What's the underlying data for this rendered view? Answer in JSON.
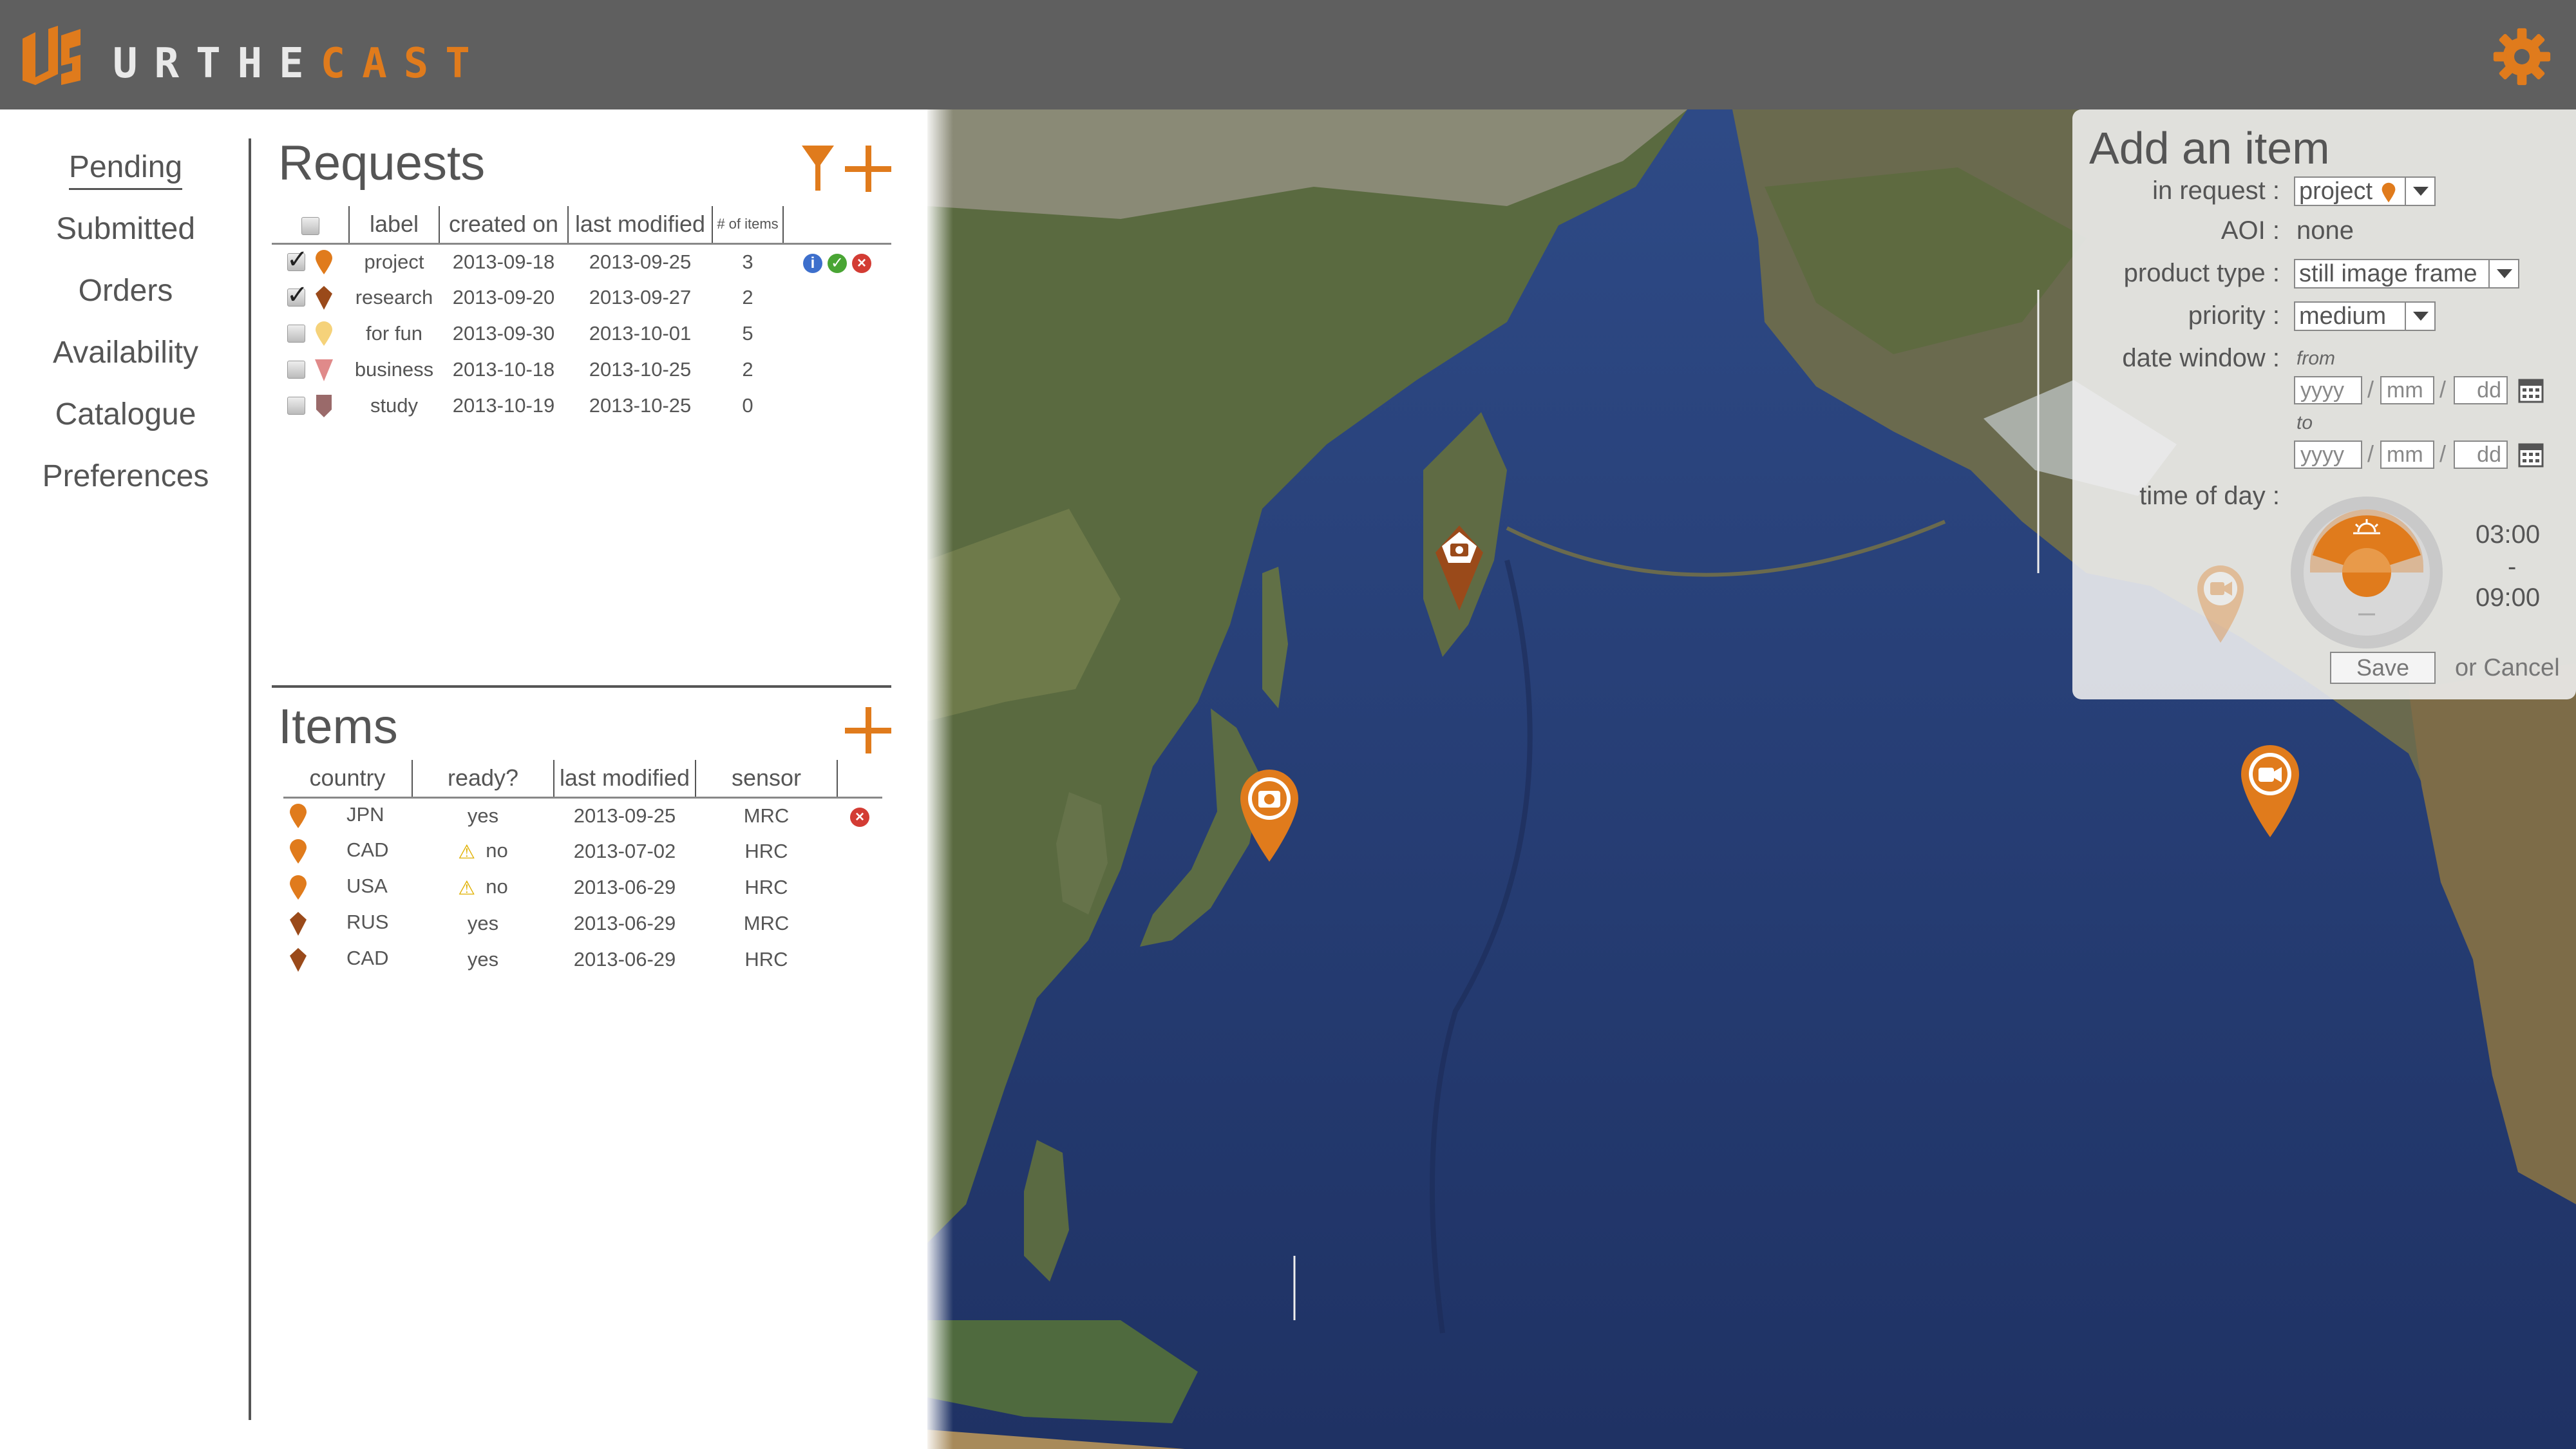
{
  "header": {
    "brand_part1": "URTHE",
    "brand_part2": "CAST",
    "colors": {
      "accent": "#e07b1c",
      "topbar": "#5f5f5f"
    }
  },
  "nav": {
    "items": [
      {
        "label": "Pending",
        "active": true
      },
      {
        "label": "Submitted"
      },
      {
        "label": "Orders"
      },
      {
        "label": "Availability"
      },
      {
        "label": "Catalogue"
      },
      {
        "label": "Preferences"
      }
    ]
  },
  "requests": {
    "title": "Requests",
    "columns": {
      "label": "label",
      "created": "created on",
      "modified": "last modified",
      "count": "# of items"
    },
    "rows": [
      {
        "checked": true,
        "pin_color": "#e07b1c",
        "label": "project",
        "created": "2013-09-18",
        "modified": "2013-09-25",
        "count": "3"
      },
      {
        "checked": true,
        "pin_color": "#9a4a1a",
        "label": "research",
        "created": "2013-09-20",
        "modified": "2013-09-27",
        "count": "2"
      },
      {
        "checked": false,
        "pin_color": "#f5d27a",
        "label": "for fun",
        "created": "2013-09-30",
        "modified": "2013-10-01",
        "count": "5"
      },
      {
        "checked": false,
        "pin_color": "#e08a8a",
        "label": "business",
        "created": "2013-10-18",
        "modified": "2013-10-25",
        "count": "2"
      },
      {
        "checked": false,
        "pin_color": "#9a6a6a",
        "label": "study",
        "created": "2013-10-19",
        "modified": "2013-10-25",
        "count": "0"
      }
    ]
  },
  "items": {
    "title": "Items",
    "columns": {
      "country": "country",
      "ready": "ready?",
      "modified": "last modified",
      "sensor": "sensor"
    },
    "rows": [
      {
        "pin_color": "#e07b1c",
        "country": "JPN",
        "warn": false,
        "ready": "yes",
        "modified": "2013-09-25",
        "sensor": "MRC"
      },
      {
        "pin_color": "#e07b1c",
        "country": "CAD",
        "warn": true,
        "ready": "no",
        "modified": "2013-07-02",
        "sensor": "HRC"
      },
      {
        "pin_color": "#e07b1c",
        "country": "USA",
        "warn": true,
        "ready": "no",
        "modified": "2013-06-29",
        "sensor": "HRC"
      },
      {
        "pin_color": "#9a4a1a",
        "country": "RUS",
        "warn": false,
        "ready": "yes",
        "modified": "2013-06-29",
        "sensor": "MRC"
      },
      {
        "pin_color": "#9a4a1a",
        "country": "CAD",
        "warn": false,
        "ready": "yes",
        "modified": "2013-06-29",
        "sensor": "HRC"
      }
    ]
  },
  "add_item": {
    "title": "Add an item",
    "in_request_label": "in request :",
    "in_request_value": "project",
    "aoi_label": "AOI :",
    "aoi_value": "none",
    "product_type_label": "product type :",
    "product_type_value": "still image frame",
    "priority_label": "priority :",
    "priority_value": "medium",
    "date_window_label": "date window :",
    "from_label": "from",
    "to_label": "to",
    "yyyy_placeholder": "yyyy",
    "mm_placeholder": "mm",
    "dd_placeholder": "dd",
    "time_of_day_label": "time of day :",
    "time_from": "03:00",
    "time_dash": "-",
    "time_to": "09:00",
    "save_label": "Save",
    "cancel_label": "or Cancel"
  }
}
